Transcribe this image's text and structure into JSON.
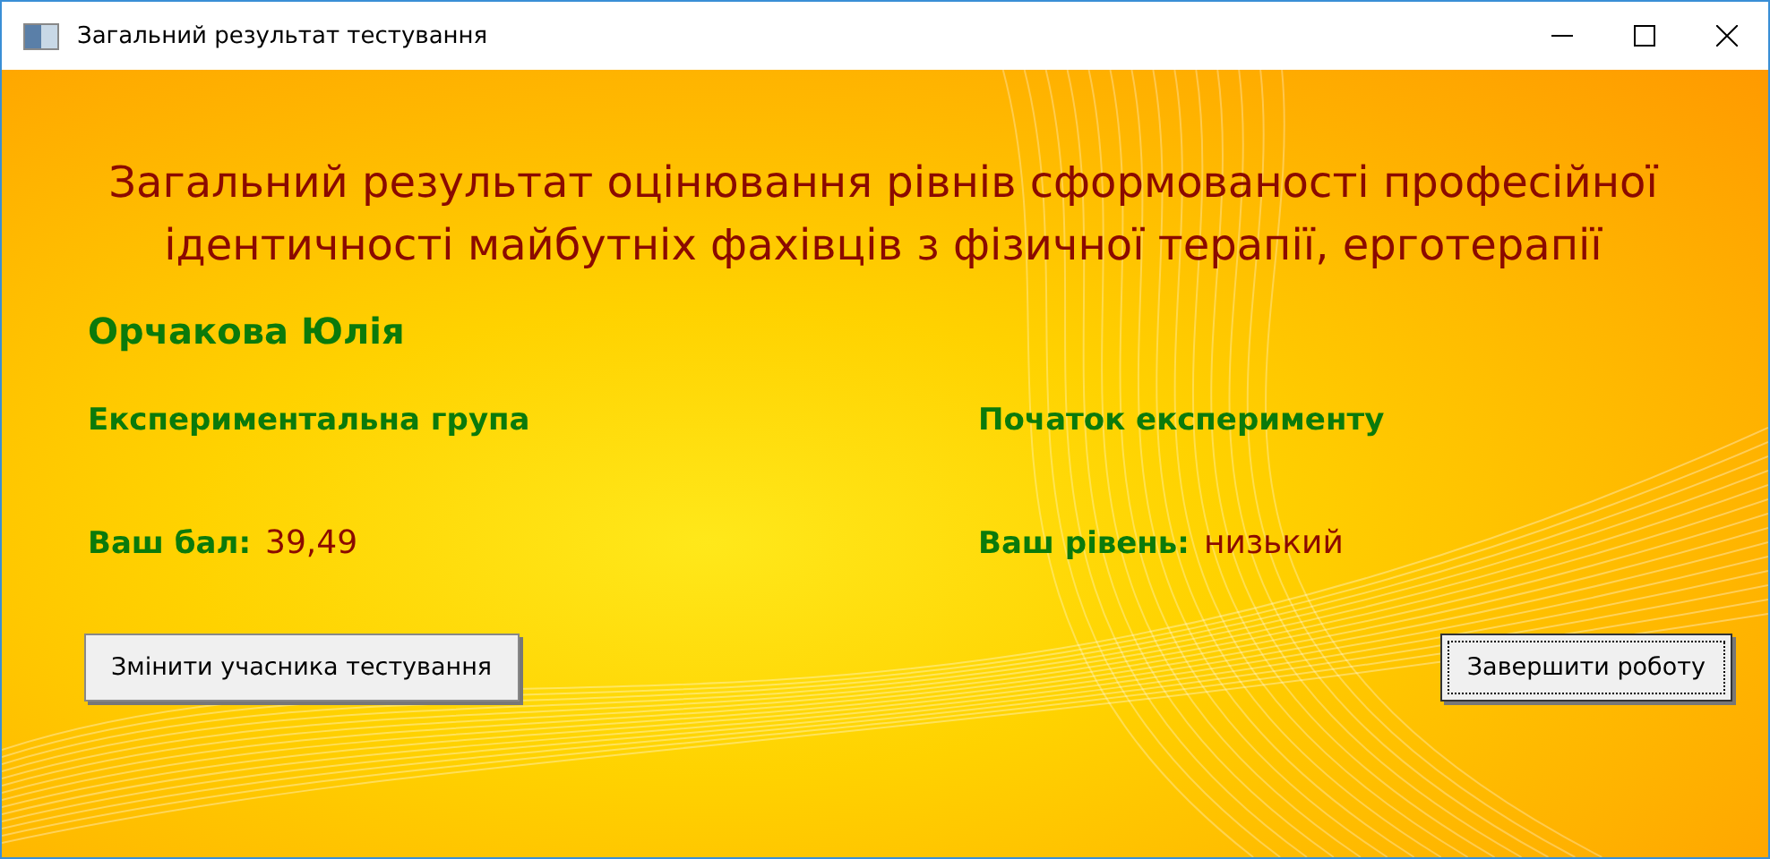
{
  "window": {
    "title": "Загальний результат тестування"
  },
  "heading": "Загальний результат оцінювання рівнів сформованості професійної ідентичності майбутніх фахівців з фізичної терапії, ерготерапії",
  "participant": "Орчакова Юлія",
  "group": "Експериментальна група",
  "stage": "Початок експерименту",
  "score": {
    "label": "Ваш бал:",
    "value": "39,49"
  },
  "level": {
    "label": "Ваш рівень:",
    "value": "низький"
  },
  "buttons": [
    {
      "label": "Змінити учасника тестування",
      "focused": false
    },
    {
      "label": "Завершити роботу",
      "focused": true
    }
  ]
}
